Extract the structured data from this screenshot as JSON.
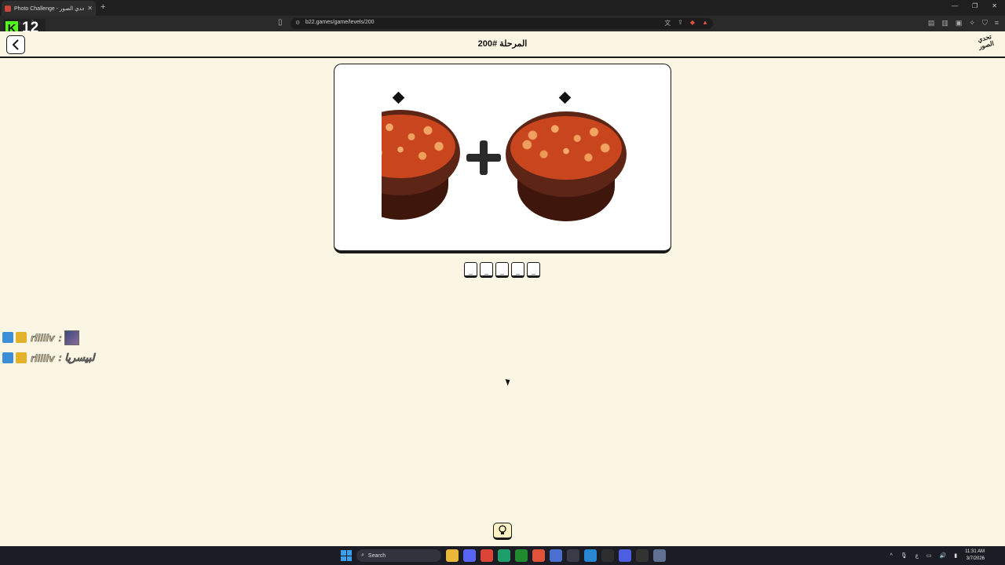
{
  "browser": {
    "tab_title": "Photo Challenge - تحدي الصور",
    "url": "b22.games/game/levels/200"
  },
  "overlay": {
    "k_letter": "K",
    "counter": "12"
  },
  "header": {
    "level_title": "المرحلة #200",
    "logo_line1": "تحدي",
    "logo_line2": "الصور"
  },
  "answer": {
    "slots": [
      "_",
      "_",
      "_",
      "_",
      "_"
    ]
  },
  "chat": {
    "messages": [
      {
        "user": "rlllllv",
        "text": ":"
      },
      {
        "user": "rlllllv",
        "text": ": لبيسريا"
      }
    ]
  },
  "taskbar": {
    "search_label": "Search",
    "time": "11:31 AM",
    "date": "3/7/2026"
  }
}
